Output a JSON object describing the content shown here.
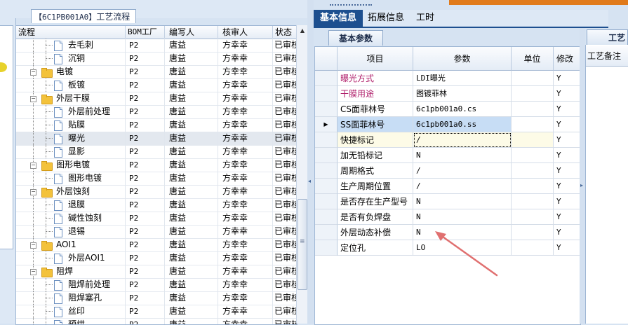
{
  "left_panel": {
    "tab_code": "【6C1PB001A0】",
    "tab_title": "工艺流程",
    "columns": [
      "流程",
      "BOM工厂",
      "编写人",
      "核审人",
      "状态"
    ],
    "rows": [
      {
        "name": "去毛刺",
        "level": 2,
        "kind": "doc",
        "bom": "P2",
        "writer": "唐益",
        "reviewer": "方幸幸",
        "status": "已审核"
      },
      {
        "name": "沉铜",
        "level": 2,
        "kind": "doc",
        "bom": "P2",
        "writer": "唐益",
        "reviewer": "方幸幸",
        "status": "已审核"
      },
      {
        "name": "电镀",
        "level": 1,
        "kind": "folder",
        "bom": "P2",
        "writer": "唐益",
        "reviewer": "方幸幸",
        "status": "已审核"
      },
      {
        "name": "板镀",
        "level": 2,
        "kind": "doc",
        "bom": "P2",
        "writer": "唐益",
        "reviewer": "方幸幸",
        "status": "已审核"
      },
      {
        "name": "外层干膜",
        "level": 1,
        "kind": "folder",
        "bom": "P2",
        "writer": "唐益",
        "reviewer": "方幸幸",
        "status": "已审核"
      },
      {
        "name": "外层前处理",
        "level": 2,
        "kind": "doc",
        "bom": "P2",
        "writer": "唐益",
        "reviewer": "方幸幸",
        "status": "已审核"
      },
      {
        "name": "贴膜",
        "level": 2,
        "kind": "doc",
        "bom": "P2",
        "writer": "唐益",
        "reviewer": "方幸幸",
        "status": "已审核"
      },
      {
        "name": "曝光",
        "level": 2,
        "kind": "doc",
        "bom": "P2",
        "writer": "唐益",
        "reviewer": "方幸幸",
        "status": "已审核",
        "selected": true
      },
      {
        "name": "显影",
        "level": 2,
        "kind": "doc",
        "bom": "P2",
        "writer": "唐益",
        "reviewer": "方幸幸",
        "status": "已审核"
      },
      {
        "name": "图形电镀",
        "level": 1,
        "kind": "folder",
        "bom": "P2",
        "writer": "唐益",
        "reviewer": "方幸幸",
        "status": "已审核"
      },
      {
        "name": "图形电镀",
        "level": 2,
        "kind": "doc",
        "bom": "P2",
        "writer": "唐益",
        "reviewer": "方幸幸",
        "status": "已审核"
      },
      {
        "name": "外层蚀刻",
        "level": 1,
        "kind": "folder",
        "bom": "P2",
        "writer": "唐益",
        "reviewer": "方幸幸",
        "status": "已审核"
      },
      {
        "name": "退膜",
        "level": 2,
        "kind": "doc",
        "bom": "P2",
        "writer": "唐益",
        "reviewer": "方幸幸",
        "status": "已审核"
      },
      {
        "name": "碱性蚀刻",
        "level": 2,
        "kind": "doc",
        "bom": "P2",
        "writer": "唐益",
        "reviewer": "方幸幸",
        "status": "已审核"
      },
      {
        "name": "退锡",
        "level": 2,
        "kind": "doc",
        "bom": "P2",
        "writer": "唐益",
        "reviewer": "方幸幸",
        "status": "已审核"
      },
      {
        "name": "AOI1",
        "level": 1,
        "kind": "folder",
        "bom": "P2",
        "writer": "唐益",
        "reviewer": "方幸幸",
        "status": "已审核"
      },
      {
        "name": "外层AOI1",
        "level": 2,
        "kind": "doc",
        "bom": "P2",
        "writer": "唐益",
        "reviewer": "方幸幸",
        "status": "已审核"
      },
      {
        "name": "阻焊",
        "level": 1,
        "kind": "folder",
        "bom": "P2",
        "writer": "唐益",
        "reviewer": "方幸幸",
        "status": "已审核"
      },
      {
        "name": "阻焊前处理",
        "level": 2,
        "kind": "doc",
        "bom": "P2",
        "writer": "唐益",
        "reviewer": "方幸幸",
        "status": "已审核"
      },
      {
        "name": "阻焊塞孔",
        "level": 2,
        "kind": "doc",
        "bom": "P2",
        "writer": "唐益",
        "reviewer": "方幸幸",
        "status": "已审核"
      },
      {
        "name": "丝印",
        "level": 2,
        "kind": "doc",
        "bom": "P2",
        "writer": "唐益",
        "reviewer": "方幸幸",
        "status": "已审核"
      },
      {
        "name": "预烘",
        "level": 2,
        "kind": "doc",
        "bom": "P2",
        "writer": "唐益",
        "reviewer": "方幸幸",
        "status": "已审核"
      }
    ]
  },
  "right_panel": {
    "tabs": [
      "基本信息",
      "拓展信息",
      "工时"
    ],
    "active_tab": 0,
    "subtab": "基本参数",
    "columns": [
      "项目",
      "参数",
      "单位",
      "修改"
    ],
    "rows": [
      {
        "name": "曝光方式",
        "param": "LDI曝光",
        "unit": "",
        "mod": "Y",
        "pink": true
      },
      {
        "name": "干膜用途",
        "param": "图镀菲林",
        "unit": "",
        "mod": "Y",
        "pink": true
      },
      {
        "name": "CS面菲林号",
        "param": "6c1pb001a0.cs",
        "unit": "",
        "mod": "Y"
      },
      {
        "name": "SS面菲林号",
        "param": "6c1pb001a0.ss",
        "unit": "",
        "mod": "Y",
        "selected": true
      },
      {
        "name": "快捷标记",
        "param": "/",
        "unit": "",
        "mod": "Y",
        "dashed": true
      },
      {
        "name": "加无铅标记",
        "param": "N",
        "unit": "",
        "mod": "Y"
      },
      {
        "name": "周期格式",
        "param": "/",
        "unit": "",
        "mod": "Y"
      },
      {
        "name": "生产周期位置",
        "param": "/",
        "unit": "",
        "mod": "Y"
      },
      {
        "name": "是否存在生产型号",
        "param": "N",
        "unit": "",
        "mod": "Y"
      },
      {
        "name": "是否有负焊盘",
        "param": "N",
        "unit": "",
        "mod": "Y"
      },
      {
        "name": "外层动态补偿",
        "param": "N",
        "unit": "",
        "mod": "Y"
      },
      {
        "name": "定位孔",
        "param": "LO",
        "unit": "",
        "mod": "Y"
      }
    ]
  },
  "far_right": {
    "tab": "工艺",
    "header": "工艺备注"
  },
  "colors": {
    "accent": "#1d4f8f",
    "pink_label": "#b0216c",
    "selection": "#c7ddf5",
    "annotation_arrow": "#e07070"
  }
}
